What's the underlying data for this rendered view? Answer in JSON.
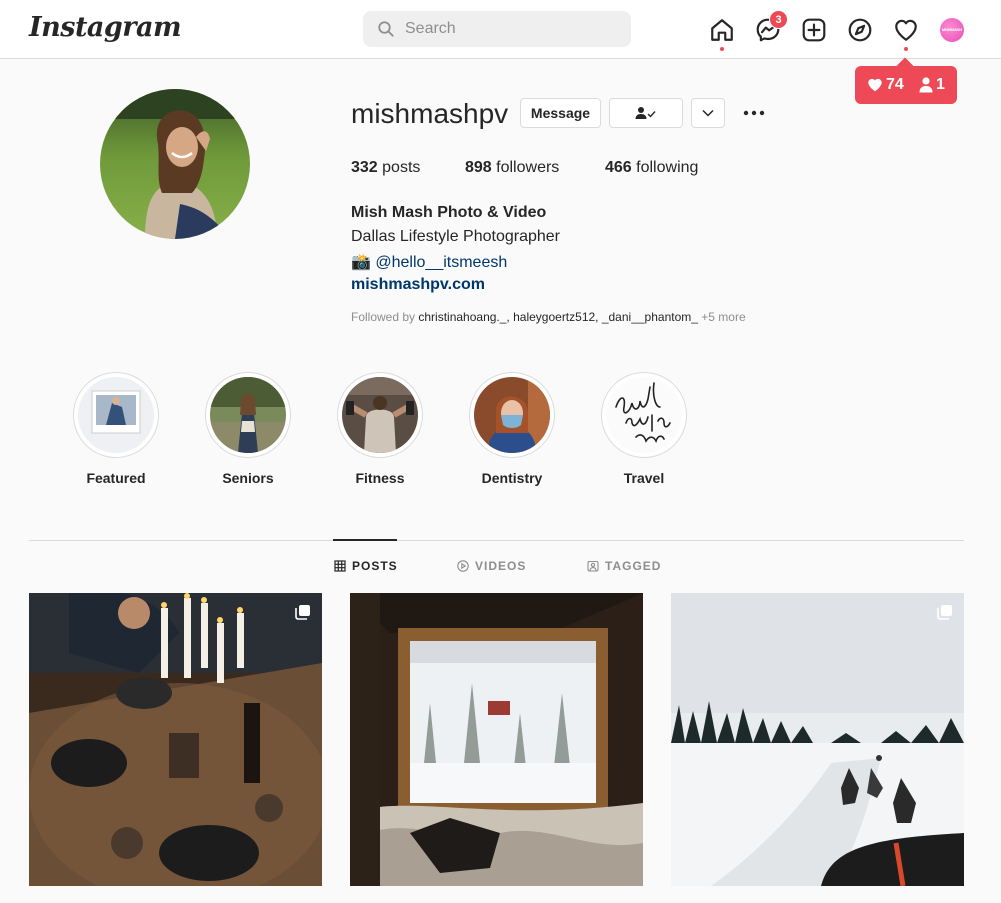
{
  "app": {
    "logo_text": "Instagram"
  },
  "search": {
    "placeholder": "Search",
    "value": ""
  },
  "nav": {
    "messenger_badge": "3",
    "avatar_text": "MISHMASH",
    "icons": [
      "home-icon",
      "messenger-icon",
      "new-post-icon",
      "explore-icon",
      "heart-icon"
    ]
  },
  "notification": {
    "likes": "74",
    "follows": "1"
  },
  "profile": {
    "username": "mishmashpv",
    "message_label": "Message",
    "stats": {
      "posts_count": "332",
      "posts_label": "posts",
      "followers_count": "898",
      "followers_label": "followers",
      "following_count": "466",
      "following_label": "following"
    },
    "full_name": "Mish Mash Photo & Video",
    "bio_line1": "Dallas Lifestyle Photographer",
    "bio_emoji": "📸",
    "bio_mention": "@hello__itsmeesh",
    "website": "mishmashpv.com",
    "followed_by_label": "Followed by",
    "followed_by_names": "christinahoang._, haleygoertz512, _dani__phantom_",
    "followed_by_more": "+5 more"
  },
  "highlights": [
    {
      "label": "Featured"
    },
    {
      "label": "Seniors"
    },
    {
      "label": "Fitness"
    },
    {
      "label": "Dentistry"
    },
    {
      "label": "Travel"
    }
  ],
  "tabs": [
    {
      "label": "POSTS",
      "active": true
    },
    {
      "label": "VIDEOS",
      "active": false
    },
    {
      "label": "TAGGED",
      "active": false
    }
  ],
  "colors": {
    "accent_red": "#ed4956",
    "link_blue": "#00376b",
    "border": "#dbdbdb"
  }
}
